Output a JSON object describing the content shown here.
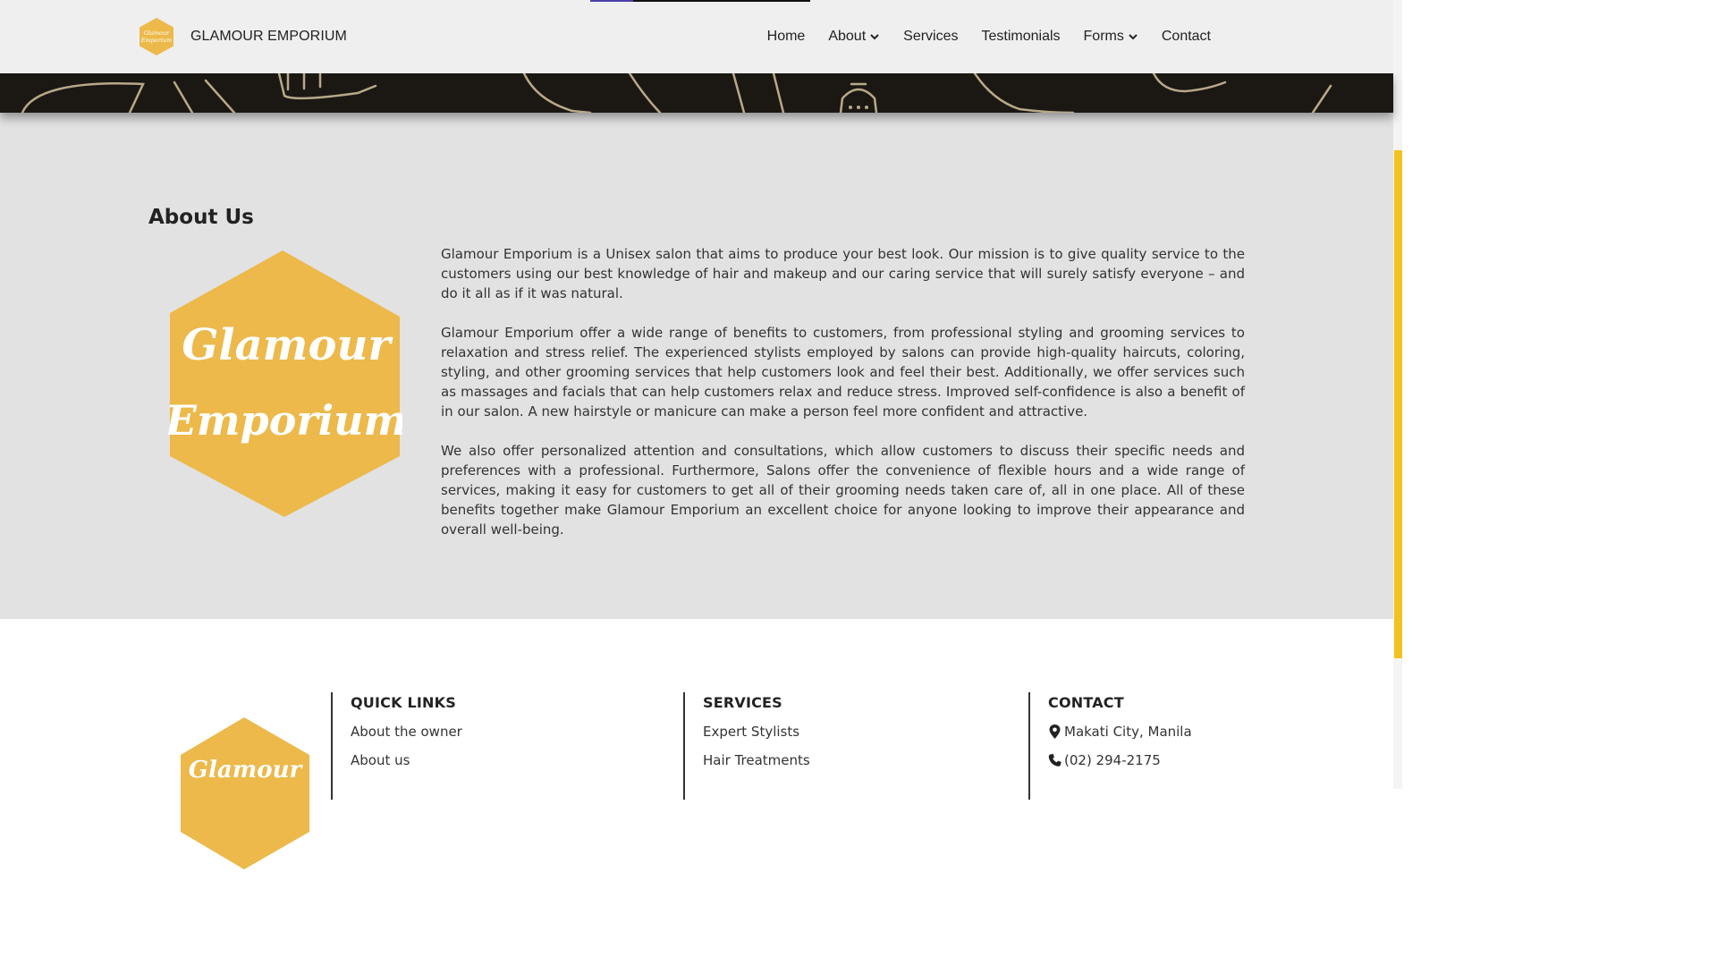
{
  "nav": {
    "brand_name": "GLAMOUR EMPORIUM",
    "logo_text_line1": "Glamour",
    "logo_text_line2": "Emporium",
    "items": [
      {
        "label": "Home"
      },
      {
        "label": "About",
        "has_dropdown": true
      },
      {
        "label": "Services"
      },
      {
        "label": "Testimonials"
      },
      {
        "label": "Forms",
        "has_dropdown": true
      },
      {
        "label": "Contact"
      }
    ]
  },
  "about": {
    "title": "About Us",
    "logo_line1": "Glamour",
    "logo_line2": "Emporium",
    "paragraphs": [
      "Glamour Emporium is a Unisex salon that aims to produce your best look. Our mission is to give quality service to the customers using our best knowledge of hair and makeup and our caring service that will surely satisfy everyone – and do it all as if it was natural.",
      "Glamour Emporium offer a wide range of benefits to customers, from professional styling and grooming services to relaxation and stress relief. The experienced stylists employed by salons can provide high-quality haircuts, coloring, styling, and other grooming services that help customers look and feel their best. Additionally, we offer services such as massages and facials that can help customers relax and reduce stress. Improved self-confidence is also a benefit of in our salon. A new hairstyle or manicure can make a person feel more confident and attractive.",
      "We also offer personalized attention and consultations, which allow customers to discuss their specific needs and preferences with a professional. Furthermore, Salons offer the convenience of flexible hours and a wide range of services, making it easy for customers to get all of their grooming needs taken care of, all in one place. All of these benefits together make Glamour Emporium an excellent choice for anyone looking to improve their appearance and overall well-being."
    ]
  },
  "footer": {
    "logo_line1": "Glamour",
    "quick_links": {
      "heading": "QUICK LINKS",
      "items": [
        "About the owner",
        "About us"
      ]
    },
    "services": {
      "heading": "SERVICES",
      "items": [
        "Expert Stylists",
        "Hair Treatments"
      ]
    },
    "contact": {
      "heading": "CONTACT",
      "address": "Makati City, Manila",
      "phone": "(02) 294-2175"
    }
  },
  "colors": {
    "accent_gold": "#ecb94a",
    "nav_bg": "#efefef",
    "hero_bg": "#1b1814",
    "about_bg": "#e2e2e2",
    "scroll_thumb": "#f3c21f"
  }
}
